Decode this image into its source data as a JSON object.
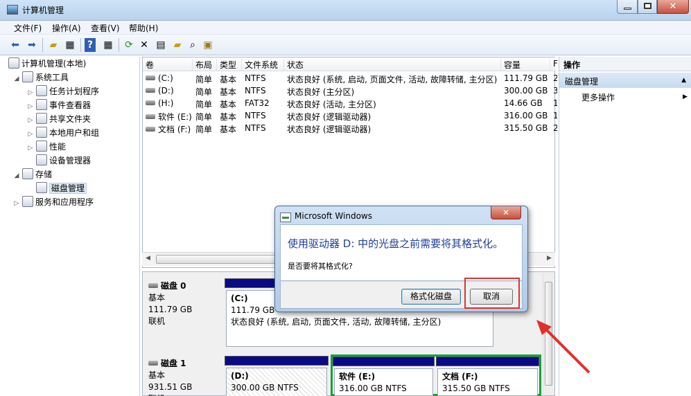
{
  "window": {
    "title": "计算机管理",
    "close_glyph": "✕"
  },
  "menu": [
    "文件(F)",
    "操作(A)",
    "查看(V)",
    "帮助(H)"
  ],
  "toolbar_icons": [
    "back-arrow-icon",
    "forward-arrow-icon",
    "up-folder-icon",
    "show-tree-icon",
    "help-icon",
    "show-pane-icon",
    "refresh-icon",
    "delete-icon",
    "properties-icon",
    "open-icon",
    "search-icon",
    "format-icon"
  ],
  "tree": {
    "root": "计算机管理(本地)",
    "system_tools": "系统工具",
    "task_scheduler": "任务计划程序",
    "event_viewer": "事件查看器",
    "shared_folders": "共享文件夹",
    "local_users": "本地用户和组",
    "performance": "性能",
    "device_manager": "设备管理器",
    "storage": "存储",
    "disk_management": "磁盘管理",
    "services": "服务和应用程序"
  },
  "volume_table": {
    "headers": [
      "卷",
      "布局",
      "类型",
      "文件系统",
      "状态",
      "容量",
      "F"
    ],
    "rows": [
      {
        "vol": "(C:)",
        "layout": "简单",
        "type": "基本",
        "fs": "NTFS",
        "status": "状态良好 (系统, 启动, 页面文件, 活动, 故障转储, 主分区)",
        "cap": "111.79 GB",
        "f": "2"
      },
      {
        "vol": "(D:)",
        "layout": "简单",
        "type": "基本",
        "fs": "NTFS",
        "status": "状态良好 (主分区)",
        "cap": "300.00 GB",
        "f": "3"
      },
      {
        "vol": "(H:)",
        "layout": "简单",
        "type": "基本",
        "fs": "FAT32",
        "status": "状态良好 (活动, 主分区)",
        "cap": "14.66 GB",
        "f": "1"
      },
      {
        "vol": "软件 (E:)",
        "layout": "简单",
        "type": "基本",
        "fs": "NTFS",
        "status": "状态良好 (逻辑驱动器)",
        "cap": "316.00 GB",
        "f": "1"
      },
      {
        "vol": "文档 (F:)",
        "layout": "简单",
        "type": "基本",
        "fs": "NTFS",
        "status": "状态良好 (逻辑驱动器)",
        "cap": "315.50 GB",
        "f": "2"
      }
    ]
  },
  "disks": {
    "disk0": {
      "name": "磁盘 0",
      "type": "基本",
      "size": "111.79 GB",
      "state": "联机",
      "part_name": "(C:)",
      "part_size": "111.79 GB",
      "part_status": "状态良好 (系统, 启动, 页面文件, 活动, 故障转储, 主分区)"
    },
    "disk1": {
      "name": "磁盘 1",
      "type": "基本",
      "size": "931.51 GB",
      "state": "联机",
      "d_name": "(D:)",
      "d_size": "300.00 GB NTFS",
      "e_name": "软件  (E:)",
      "e_size": "316.00 GB NTFS",
      "f_name": "文档  (F:)",
      "f_size": "315.50 GB NTFS"
    }
  },
  "actions": {
    "title": "操作",
    "section": "磁盘管理",
    "more": "更多操作",
    "collapse_glyph": "▲",
    "expand_glyph": "▶"
  },
  "dialog": {
    "title": "Microsoft Windows",
    "close_glyph": "✕",
    "message": "使用驱动器 D: 中的光盘之前需要将其格式化。",
    "question": "是否要将其格式化?",
    "format_button": "格式化磁盘",
    "cancel_button": "取消"
  },
  "colors": {
    "highlight": "#e0302c",
    "primary_bar": "#0a0a84",
    "logical_frame": "#16a03a",
    "dialog_text": "#1d3f9a"
  }
}
